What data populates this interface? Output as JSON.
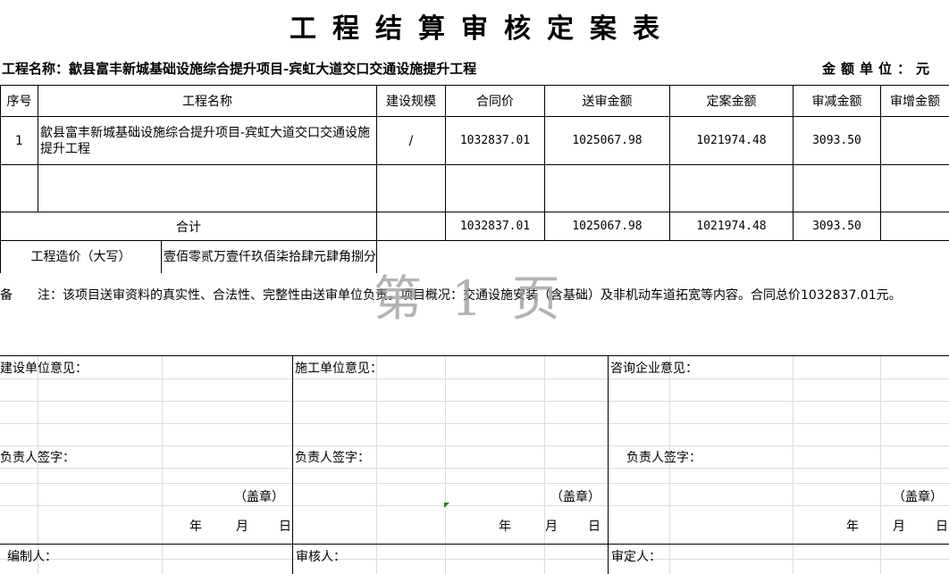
{
  "title": "工程结算审核定案表",
  "project_line": "工程名称：歙县富丰新城基础设施综合提升项目-宾虹大道交口交通设施提升工程",
  "unit_line": "金额单位：元",
  "table": {
    "headers": [
      "序号",
      "工程名称",
      "建设规模",
      "合同价",
      "送审金额",
      "定案金额",
      "审减金额",
      "审增金额"
    ],
    "rows": [
      {
        "seq": "1",
        "name": "歙县富丰新城基础设施综合提升项目-宾虹大道交口交通设施提升工程",
        "scale": "/",
        "contract": "1032837.01",
        "submitted": "1025067.98",
        "approved": "1021974.48",
        "reduced": "3093.50",
        "increased": ""
      }
    ],
    "total": {
      "label": "合计",
      "contract": "1032837.01",
      "submitted": "1025067.98",
      "approved": "1021974.48",
      "reduced": "3093.50"
    },
    "cost_label": "工程造价（大写）",
    "cost_value": "壹佰零贰万壹仟玖佰柒拾肆元肆角捌分"
  },
  "remark": {
    "label": "备　　注：",
    "text": "该项目送审资料的真实性、合法性、完整性由送审单位负责。项目概况：交通设施安装（含基础）及非机动车道拓宽等内容。合同总价1032837.01元。"
  },
  "watermark": "第 1 页",
  "sign": {
    "opinions": [
      "建设单位意见：",
      "施工单位意见：",
      "咨询企业意见："
    ],
    "signature": "负责人签字：",
    "seal": "（盖章）",
    "year": "年",
    "month": "月",
    "day": "日"
  },
  "footer": {
    "compiler": "编制人：",
    "reviewer": "审核人：",
    "approver": "审定人："
  }
}
